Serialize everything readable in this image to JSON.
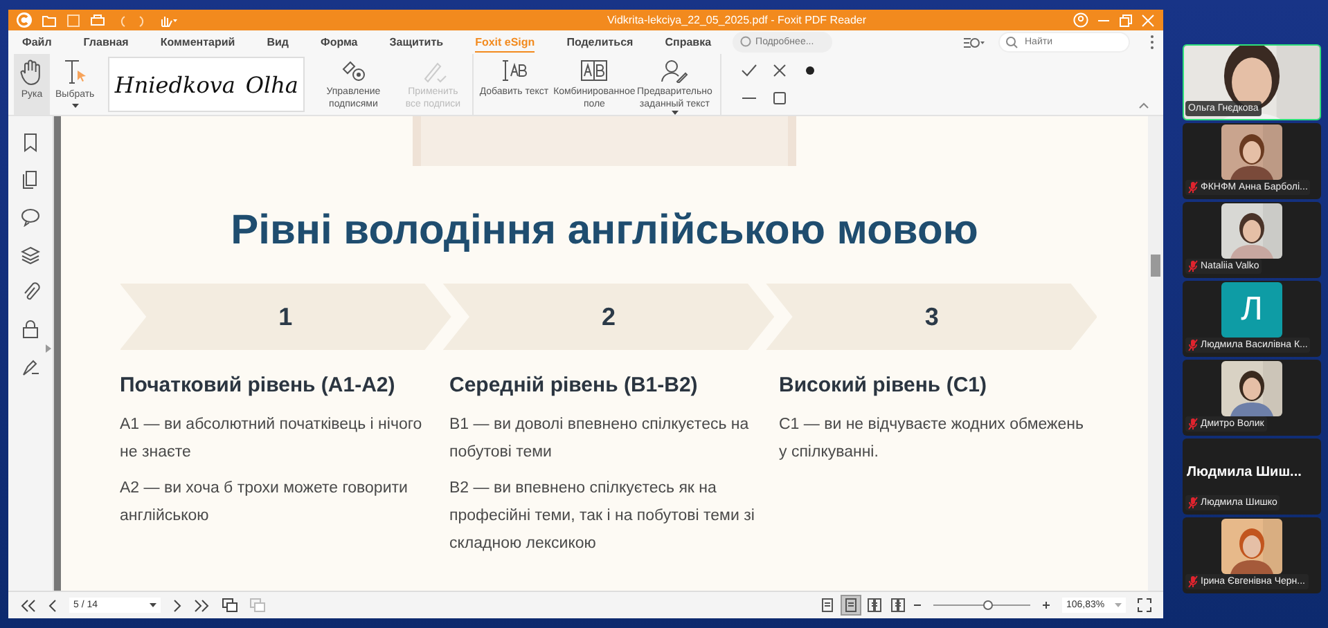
{
  "window": {
    "title": "Vidkrita-lekciya_22_05_2025.pdf - Foxit PDF Reader"
  },
  "menu": [
    {
      "label": "Файл",
      "selected": false
    },
    {
      "label": "Главная",
      "selected": false
    },
    {
      "label": "Комментарий",
      "selected": false
    },
    {
      "label": "Вид",
      "selected": false
    },
    {
      "label": "Форма",
      "selected": false
    },
    {
      "label": "Защитить",
      "selected": false
    },
    {
      "label": "Foxit eSign",
      "selected": true
    },
    {
      "label": "Поделиться",
      "selected": false
    },
    {
      "label": "Справка",
      "selected": false
    }
  ],
  "help_search": {
    "placeholder": "Подробнее..."
  },
  "search": {
    "placeholder": "Найти"
  },
  "ribbon": {
    "tools": [
      {
        "label": "Рука",
        "selected": true,
        "dropdown": false
      },
      {
        "label": "Выбрать",
        "selected": false,
        "dropdown": true
      }
    ],
    "signature": [
      "Hniedkova",
      "Olha"
    ],
    "actions": [
      {
        "label": "Управление подписями",
        "disabled": false,
        "dropdown": false
      },
      {
        "label": "Применить все подписи",
        "disabled": true,
        "dropdown": false
      },
      {
        "label": "Добавить текст",
        "disabled": false,
        "dropdown": false
      },
      {
        "label": "Комбинированное поле",
        "disabled": false,
        "dropdown": false
      },
      {
        "label": "Предварительно заданный текст",
        "disabled": false,
        "dropdown": true
      }
    ]
  },
  "page": {
    "title": "Рівні володіння англійською мовою",
    "steps": [
      "1",
      "2",
      "3"
    ],
    "columns": [
      {
        "heading": "Початковий рівень (A1-A2)",
        "paragraphs": [
          "A1 — ви абсолютний початківець і нічого не знаєте",
          "A2 — ви хоча б трохи можете говорити англійською"
        ]
      },
      {
        "heading": "Середній рівень (B1-B2)",
        "paragraphs": [
          "B1 — ви доволі впевнено спілкуєтесь на побутові теми",
          "B2 — ви впевнено спілкуєтесь як на професійні теми, так і на побутові теми зі складною лексикою"
        ]
      },
      {
        "heading": "Високий рівень (C1)",
        "paragraphs": [
          "C1 — ви не відчуваєте жодних обмежень у спілкуванні."
        ]
      }
    ]
  },
  "status_bar": {
    "page": "5 / 14",
    "view_modes": [
      {
        "selected": false
      },
      {
        "selected": true
      },
      {
        "selected": false
      },
      {
        "selected": false
      }
    ],
    "zoom_slider": {
      "level": 0.55
    },
    "zoom": "106,83%"
  },
  "participants": [
    {
      "kind": "video",
      "name": "Ольга Гнєдкова",
      "speaking": true,
      "muted": false
    },
    {
      "kind": "video",
      "name": "ФКНФМ Анна Барболі...",
      "speaking": false,
      "muted": true
    },
    {
      "kind": "video",
      "name": "Nataliia Valko",
      "speaking": false,
      "muted": true
    },
    {
      "kind": "avatar",
      "initial": "Л",
      "color": "#0e9ca5",
      "name": "Людмила Василівна К...",
      "speaking": false,
      "muted": true
    },
    {
      "kind": "video",
      "name": "Дмитро Волик",
      "speaking": false,
      "muted": true
    },
    {
      "kind": "text",
      "display": "Людмила  Шиш...",
      "name": "Людмила Шишко",
      "speaking": false,
      "muted": true
    },
    {
      "kind": "video",
      "name": "Ірина Євгенівна Черн...",
      "speaking": false,
      "muted": true
    }
  ]
}
